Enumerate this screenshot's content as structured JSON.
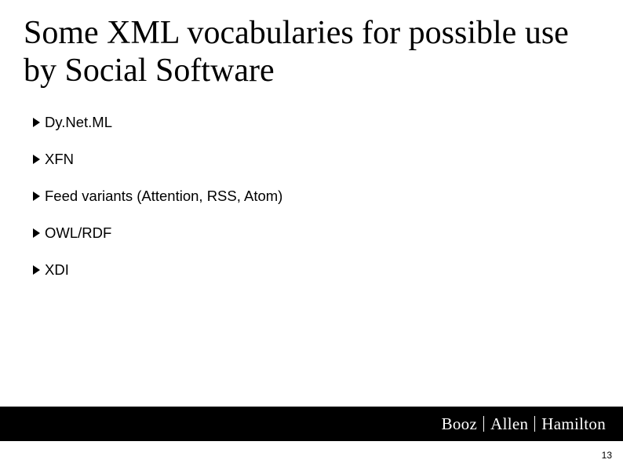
{
  "title": "Some XML vocabularies for possible use by Social Software",
  "bullets": [
    {
      "text": "Dy.Net.ML"
    },
    {
      "text": "XFN"
    },
    {
      "text": "Feed variants (Attention, RSS, Atom)"
    },
    {
      "text": "OWL/RDF"
    },
    {
      "text": "XDI"
    }
  ],
  "footer": {
    "brand_parts": [
      "Booz",
      "Allen",
      "Hamilton"
    ]
  },
  "page_number": "13"
}
